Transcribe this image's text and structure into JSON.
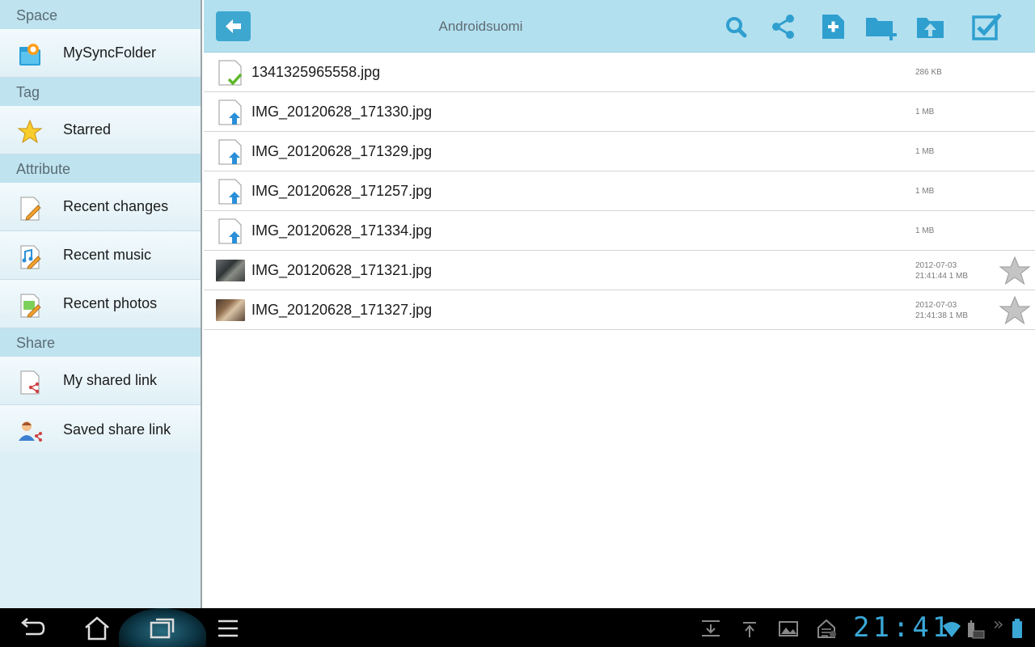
{
  "sidebar": {
    "sections": [
      {
        "title": "Space",
        "items": [
          {
            "label": "MySyncFolder",
            "icon": "sync-folder-icon"
          }
        ]
      },
      {
        "title": "Tag",
        "items": [
          {
            "label": "Starred",
            "icon": "star-icon"
          }
        ]
      },
      {
        "title": "Attribute",
        "items": [
          {
            "label": "Recent changes",
            "icon": "recent-changes-icon"
          },
          {
            "label": "Recent music",
            "icon": "recent-music-icon"
          },
          {
            "label": "Recent photos",
            "icon": "recent-photos-icon"
          }
        ]
      },
      {
        "title": "Share",
        "items": [
          {
            "label": "My shared link",
            "icon": "shared-link-icon"
          },
          {
            "label": "Saved share link",
            "icon": "saved-share-link-icon"
          }
        ]
      }
    ]
  },
  "toolbar": {
    "title": "Androidsuomi",
    "buttons": [
      "back-icon",
      "search-icon",
      "share-icon",
      "new-file-icon",
      "new-folder-icon",
      "upload-folder-icon",
      "select-checkbox-icon"
    ],
    "accent": "#3ea7cf"
  },
  "files": [
    {
      "name": "1341325965558.jpg",
      "size": "286 KB",
      "date": "",
      "time": "",
      "icon": "synced-file-icon",
      "starrable": false
    },
    {
      "name": "IMG_20120628_171330.jpg",
      "size": "1 MB",
      "date": "",
      "time": "",
      "icon": "uploading-file-icon",
      "starrable": false
    },
    {
      "name": "IMG_20120628_171329.jpg",
      "size": "1 MB",
      "date": "",
      "time": "",
      "icon": "uploading-file-icon",
      "starrable": false
    },
    {
      "name": "IMG_20120628_171257.jpg",
      "size": "1 MB",
      "date": "",
      "time": "",
      "icon": "uploading-file-icon",
      "starrable": false
    },
    {
      "name": "IMG_20120628_171334.jpg",
      "size": "1 MB",
      "date": "",
      "time": "",
      "icon": "uploading-file-icon",
      "starrable": false
    },
    {
      "name": "IMG_20120628_171321.jpg",
      "size": "1 MB",
      "date": "2012-07-03",
      "time": "21:41:44",
      "icon": "photo-thumbnail",
      "starrable": true
    },
    {
      "name": "IMG_20120628_171327.jpg",
      "size": "1 MB",
      "date": "2012-07-03",
      "time": "21:41:38",
      "icon": "photo-thumbnail",
      "starrable": true
    }
  ],
  "navbar": {
    "buttons": [
      "back-nav-icon",
      "home-icon",
      "recent-apps-icon",
      "menu-icon"
    ],
    "status_icons": [
      "download-icon",
      "upload-icon",
      "image-icon",
      "sync-status-icon",
      "wifi-icon",
      "keyboard-icon",
      "battery-icon"
    ],
    "clock": "21:41"
  }
}
